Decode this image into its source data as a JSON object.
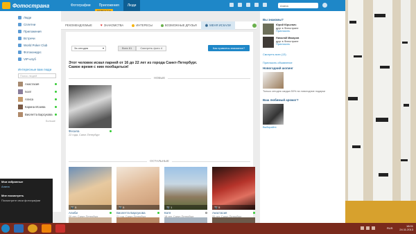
{
  "colors": {
    "brand": "#1e87c8",
    "accent": "#f6b40e",
    "online": "#33cc33",
    "taskbar": "#7a2a1c"
  },
  "topbar": {
    "logo": "Фотострана",
    "nav": [
      "Фотографии",
      "Приложения",
      "Люди"
    ],
    "active_nav": "Люди",
    "news_badge": "НОВОСТИ",
    "user_name": "Алина"
  },
  "sidebar": {
    "items": [
      {
        "label": "Люди",
        "icon": "people-icon"
      },
      {
        "label": "Сплетни",
        "icon": "gossip-icon"
      },
      {
        "label": "Приложения",
        "icon": "apps-icon"
      },
      {
        "label": "Встречи",
        "icon": "meet-icon"
      },
      {
        "label": "World Poker Club",
        "icon": "poker-icon"
      },
      {
        "label": "Фотоконкурс",
        "icon": "contest-icon"
      },
      {
        "label": "VIP-клуб",
        "icon": "vip-icon"
      }
    ],
    "section_title": "Интересные вам люди",
    "search_placeholder": "Поиск людей",
    "people": [
      "Анастасия",
      "Ivan!",
      "Алиса",
      "Карина Исаева",
      "Виолетта Барсукова"
    ],
    "more": "Больше"
  },
  "dark_panel": {
    "title": "Мои избранные",
    "line1": "Алина",
    "title2": "Мне посмотреть",
    "line2": "Посмотрите свои фотографии"
  },
  "tabs": [
    {
      "label": "Рекомендуемые",
      "icon": ""
    },
    {
      "label": "Знакомства",
      "icon": "heart-icon"
    },
    {
      "label": "Интересы",
      "icon": "interests-icon"
    },
    {
      "label": "Возможные друзья",
      "icon": "friends-icon"
    },
    {
      "label": "Меня искали",
      "icon": "eye-icon"
    }
  ],
  "main": {
    "period_select": "За сегодня",
    "seg_all": "Всех 61",
    "seg_photo": "Смотреть фото 4",
    "cta": "Как привлечь внимание?",
    "headline1": "Этот человек искал парней от 16 до 22 лет из города Санкт-Петербург.",
    "headline2": "Самое время с ним пообщаться!",
    "section_new": "НОВЫЕ",
    "section_rest": "ОСТАЛЬНЫЕ",
    "new_person": {
      "name": "Фесила",
      "info": "22 года, Санкт-Петербург"
    },
    "others": [
      {
        "name": "Алиби",
        "info": "20 лет, Санкт-Петербург",
        "count": "5",
        "online": true
      },
      {
        "name": "Виолетта Барсукова",
        "info": "21 год, Санкт-Петербург",
        "count": "5",
        "online": true
      },
      {
        "name": "Катя",
        "info": "18 лет, Санкт-Петербург",
        "count": "1",
        "online": false
      },
      {
        "name": "Анастасия",
        "info": "20 лет, Санкт-Петербург",
        "count": "5",
        "online": true
      }
    ]
  },
  "right": {
    "title": "Вы знакомы?",
    "p1_name": "Юрий Юрьевич",
    "p1_info": "друг в Фотостране",
    "p1_action": "Пригласить",
    "p2_name": "Николай Макаров",
    "p2_info": "друг в Фотостране",
    "p2_action": "Пригласить",
    "more_link": "Смотреть всех (13)",
    "invite_link": "Пригласить объявление",
    "promo_title": "Новогодний шопинг",
    "promo_text": "Только сегодня скидка 50% на новогодние подарки",
    "promo2_title": "Ваш любимый аромат?",
    "promo2_text": "Выбирайте"
  },
  "taskbar": {
    "time": "18:01",
    "date": "24.11.2013",
    "lang": "RUS"
  }
}
